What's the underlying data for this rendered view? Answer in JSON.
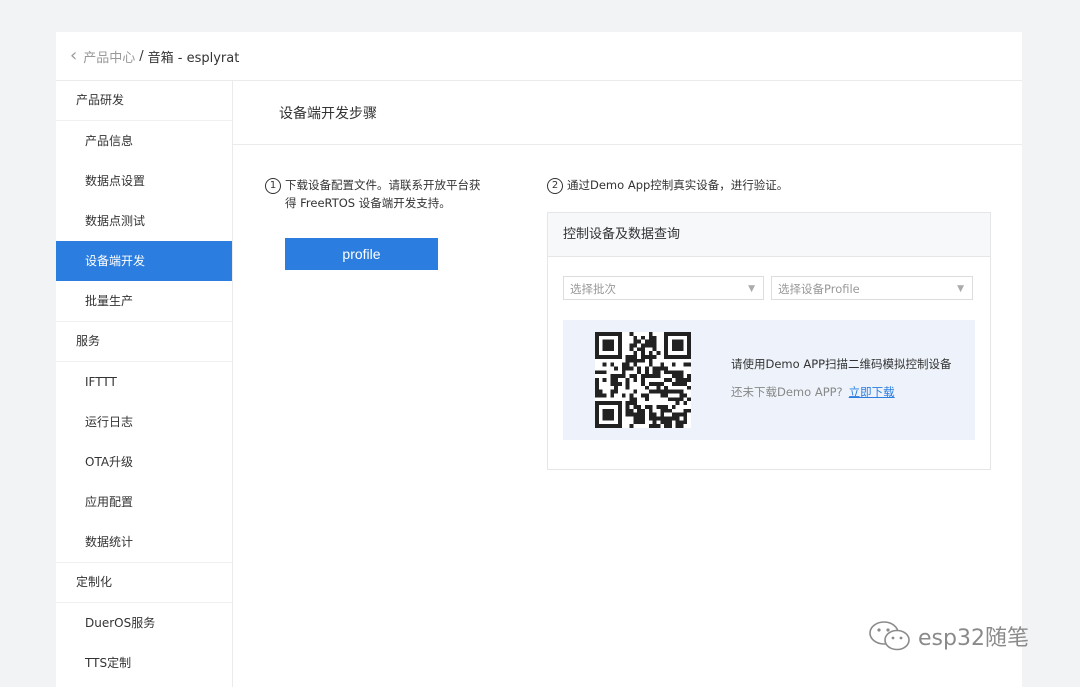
{
  "breadcrumb": {
    "parent": "产品中心",
    "separator": "/",
    "current": "音箱 - esplyrat"
  },
  "sidebar": {
    "groups": [
      {
        "label": "产品研发",
        "items": [
          {
            "label": "产品信息"
          },
          {
            "label": "数据点设置"
          },
          {
            "label": "数据点测试"
          },
          {
            "label": "设备端开发",
            "active": true
          },
          {
            "label": "批量生产"
          }
        ]
      },
      {
        "label": "服务",
        "items": [
          {
            "label": "IFTTT"
          },
          {
            "label": "运行日志"
          },
          {
            "label": "OTA升级"
          },
          {
            "label": "应用配置"
          },
          {
            "label": "数据统计"
          }
        ]
      },
      {
        "label": "定制化",
        "items": [
          {
            "label": "DuerOS服务"
          },
          {
            "label": "TTS定制"
          }
        ]
      }
    ]
  },
  "main": {
    "title": "设备端开发步骤",
    "step1": {
      "num": "1",
      "line1": "下载设备配置文件。请联系开放平台获",
      "line2": "得 FreeRTOS 设备端开发支持。",
      "button": "profile"
    },
    "step2": {
      "num": "2",
      "text": "通过Demo App控制真实设备，进行验证。"
    },
    "card": {
      "title": "控制设备及数据查询",
      "select_batch": "选择批次",
      "select_profile": "选择设备Profile",
      "qr_text": "请使用Demo APP扫描二维码模拟控制设备",
      "download_prompt": "还未下载Demo APP?",
      "download_link": "立即下载"
    }
  },
  "watermark": {
    "text": "esp32随笔",
    "icon": "wechat-icon"
  },
  "colors": {
    "accent": "#2b7de0",
    "qr_bg": "#eef3fb",
    "page_bg": "#f2f3f5"
  }
}
